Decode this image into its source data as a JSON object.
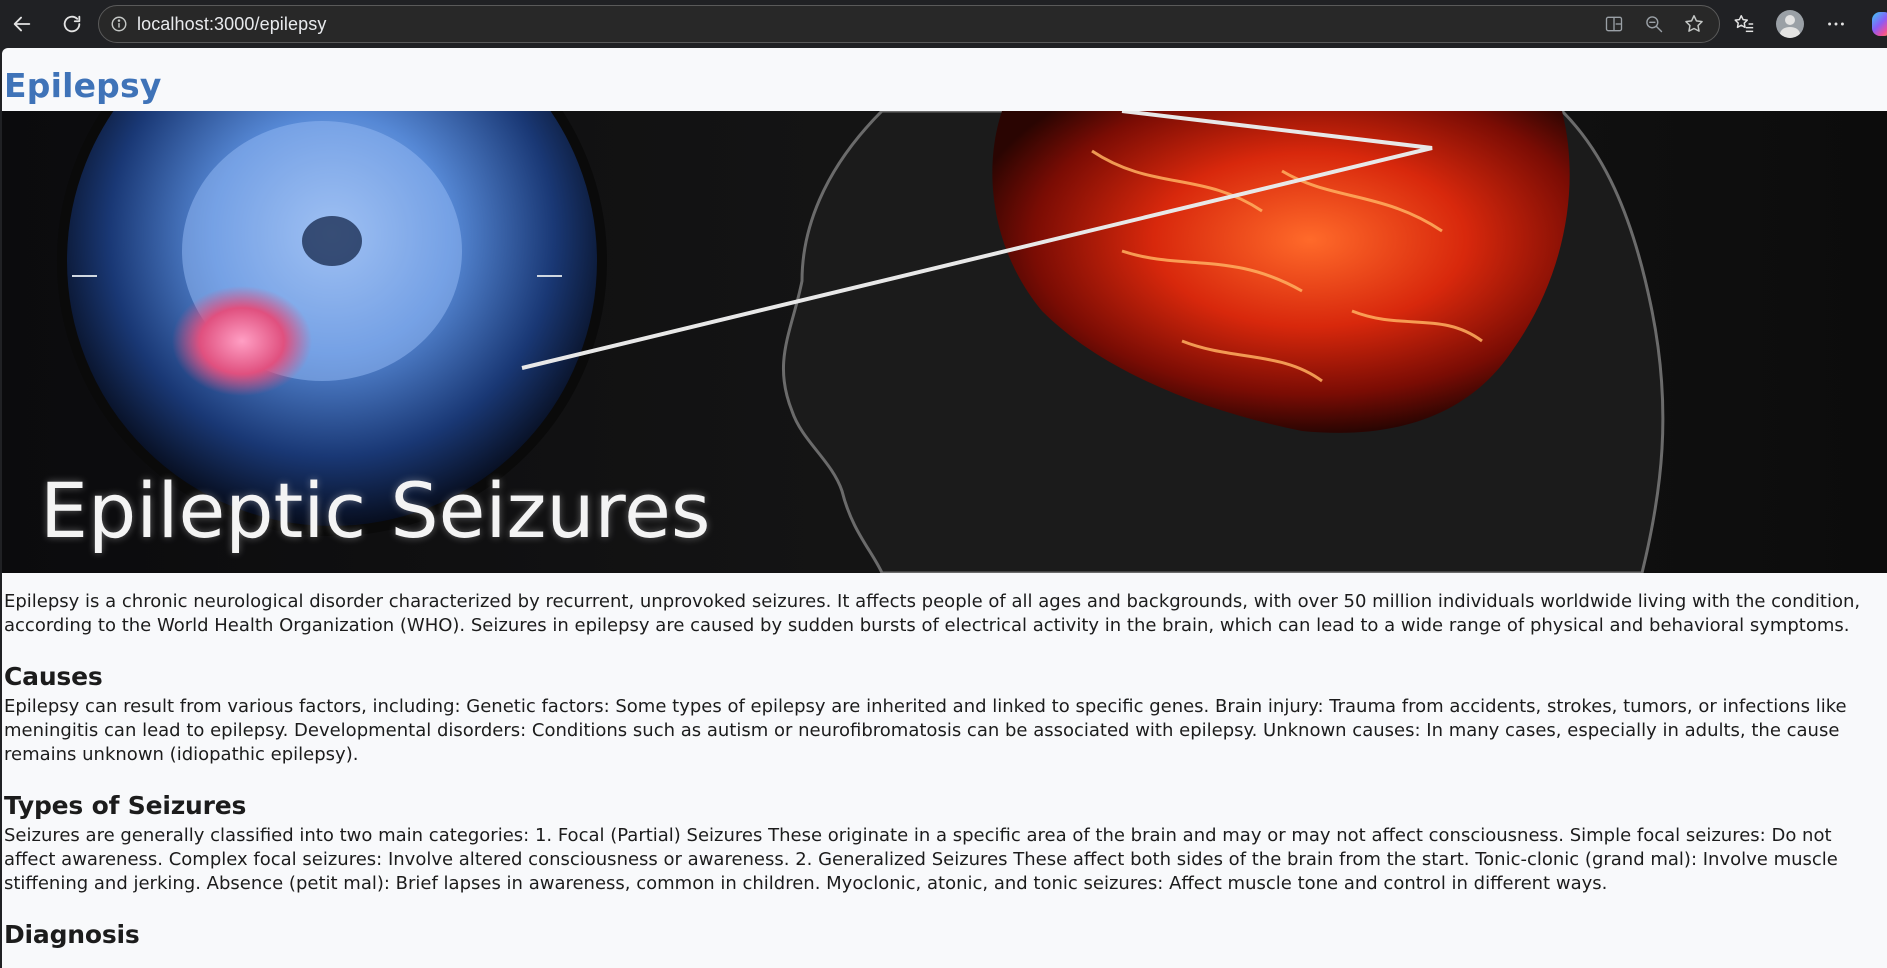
{
  "browser": {
    "url": "localhost:3000/epilepsy",
    "icons": {
      "back": "arrow-left-icon",
      "reload": "reload-icon",
      "site_info": "info-icon",
      "split": "split-screen-icon",
      "zoom": "zoom-out-icon",
      "favorite": "star-icon",
      "favorites": "favorites-list-icon",
      "profile": "profile-avatar-icon",
      "more": "more-dots-icon",
      "copilot": "copilot-icon"
    }
  },
  "page": {
    "title": "Epilepsy",
    "hero_caption": "Epileptic Seizures",
    "intro": "Epilepsy is a chronic neurological disorder characterized by recurrent, unprovoked seizures. It affects people of all ages and backgrounds, with over 50 million individuals worldwide living with the condition, according to the World Health Organization (WHO). Seizures in epilepsy are caused by sudden bursts of electrical activity in the brain, which can lead to a wide range of physical and behavioral symptoms.",
    "sections": [
      {
        "heading": "Causes",
        "body": "Epilepsy can result from various factors, including: Genetic factors: Some types of epilepsy are inherited and linked to specific genes. Brain injury: Trauma from accidents, strokes, tumors, or infections like meningitis can lead to epilepsy. Developmental disorders: Conditions such as autism or neurofibromatosis can be associated with epilepsy. Unknown causes: In many cases, especially in adults, the cause remains unknown (idiopathic epilepsy)."
      },
      {
        "heading": "Types of Seizures",
        "body": "Seizures are generally classified into two main categories: 1. Focal (Partial) Seizures These originate in a specific area of the brain and may or may not affect consciousness. Simple focal seizures: Do not affect awareness. Complex focal seizures: Involve altered consciousness or awareness. 2. Generalized Seizures These affect both sides of the brain from the start. Tonic-clonic (grand mal): Involve muscle stiffening and jerking. Absence (petit mal): Brief lapses in awareness, common in children. Myoclonic, atonic, and tonic seizures: Affect muscle tone and control in different ways."
      },
      {
        "heading": "Diagnosis",
        "body": ""
      }
    ]
  },
  "colors": {
    "title": "#3f73b8",
    "chrome_bg": "#202124",
    "page_bg": "#f8f9fb",
    "text": "#1c1c1c"
  }
}
